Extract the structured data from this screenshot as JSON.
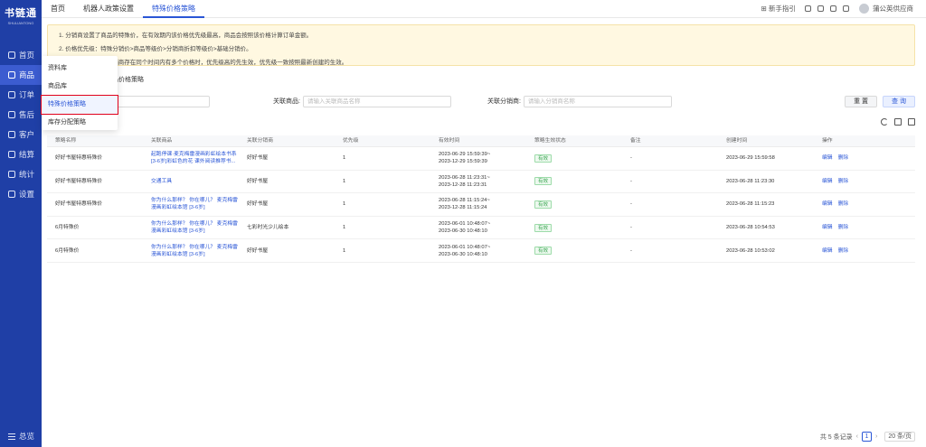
{
  "sidebar": {
    "logo_title": "书链通",
    "logo_sub": "SHULIANTONG",
    "items": [
      {
        "label": "首页",
        "icon": "home-icon"
      },
      {
        "label": "商品",
        "icon": "box-icon"
      },
      {
        "label": "订单",
        "icon": "order-icon"
      },
      {
        "label": "售后",
        "icon": "aftersale-icon"
      },
      {
        "label": "客户",
        "icon": "customer-icon"
      },
      {
        "label": "结算",
        "icon": "settle-icon"
      },
      {
        "label": "统计",
        "icon": "stats-icon"
      },
      {
        "label": "设置",
        "icon": "settings-icon"
      }
    ],
    "footer_label": "总览"
  },
  "topbar": {
    "tabs": [
      "首页",
      "机器人政策设置",
      "特殊价格策略"
    ],
    "guide": "新手指引",
    "user": "蒲公英供应商"
  },
  "notice": {
    "lines": [
      "1. 分销商设置了商品的特殊价，在有效期内该价格优先级最高，商品会按照该价格计算订单金额。",
      "2. 价格优先级：特殊分销价>商品等级价>分销商折扣等级价>基础分销价。",
      "3. 同一商品对同一分销商存在同个时间内有多个价格时，优先级高的先生效，优先级一致按照最新创建的生效。"
    ]
  },
  "strategy_title": "品价格策略",
  "filters": {
    "name_placeholder": "请输入策略名称",
    "goods_label": "关联商品:",
    "goods_placeholder": "请输入关联商品名称",
    "distributor_label": "关联分销商:",
    "distributor_placeholder": "请输入分销商名称",
    "reset": "重 置",
    "search": "查 询"
  },
  "table": {
    "headers": [
      "策略名称",
      "关联商品",
      "关联分销商",
      "优先级",
      "有效时间",
      "策略生效状态",
      "备注",
      "创建时间",
      "操作"
    ],
    "rows": [
      {
        "name": "好好书屋特惠特殊价",
        "goods": "起跑停课·麦克梅雷漫画彩虹绘本书系[3-6岁]彩虹色的花 课外阅读推荐书...",
        "dist": "好好书屋",
        "priority": "1",
        "time1": "2023-06-29 15:59:39~",
        "time2": "2023-12-29 15:59:39",
        "status": "有效",
        "note": "-",
        "created": "2023-06-29 15:59:58",
        "edit": "编辑",
        "del": "删除"
      },
      {
        "name": "好好书屋特惠特殊价",
        "goods": "交通工具",
        "dist": "好好书屋",
        "priority": "1",
        "time1": "2023-06-28 11:23:31~",
        "time2": "2023-12-28 11:23:31",
        "status": "有效",
        "note": "-",
        "created": "2023-06-28 11:23:30",
        "edit": "编辑",
        "del": "删除"
      },
      {
        "name": "好好书屋特惠特殊价",
        "goods": "你为什么那样？ 你在哪儿？ 麦克梅雷漫画彩虹绘本馆 [3-6岁]",
        "dist": "好好书屋",
        "priority": "1",
        "time1": "2023-06-28 11:15:24~",
        "time2": "2023-12-28 11:15:24",
        "status": "有效",
        "note": "-",
        "created": "2023-06-28 11:15:23",
        "edit": "编辑",
        "del": "删除"
      },
      {
        "name": "6月特殊价",
        "goods": "你为什么那样？ 你在哪儿？ 麦克梅雷漫画彩虹绘本馆 [3-6岁]",
        "dist": "七彩时光少儿绘本",
        "priority": "1",
        "time1": "2023-06-01 10:48:07~",
        "time2": "2023-06-30 10:48:10",
        "status": "有效",
        "note": "-",
        "created": "2023-06-28 10:54:53",
        "edit": "编辑",
        "del": "删除"
      },
      {
        "name": "6月特殊价",
        "goods": "你为什么那样？ 你在哪儿？ 麦克梅雷漫画彩虹绘本馆 [3-6岁]",
        "dist": "好好书屋",
        "priority": "1",
        "time1": "2023-06-01 10:48:07~",
        "time2": "2023-06-30 10:48:10",
        "status": "有效",
        "note": "-",
        "created": "2023-06-28 10:53:02",
        "edit": "编辑",
        "del": "删除"
      }
    ]
  },
  "pager": {
    "total": "共 5 条记录",
    "page": "1",
    "size": "20 条/页"
  },
  "flyout": {
    "items": [
      "资料库",
      "商品库",
      "特殊价格策略",
      "库存分配策略"
    ]
  },
  "colors": {
    "sidebar": "#1f3fa6",
    "accent": "#2a56d6",
    "notice_bg": "#fff8e1",
    "status_green": "#3aa652"
  }
}
